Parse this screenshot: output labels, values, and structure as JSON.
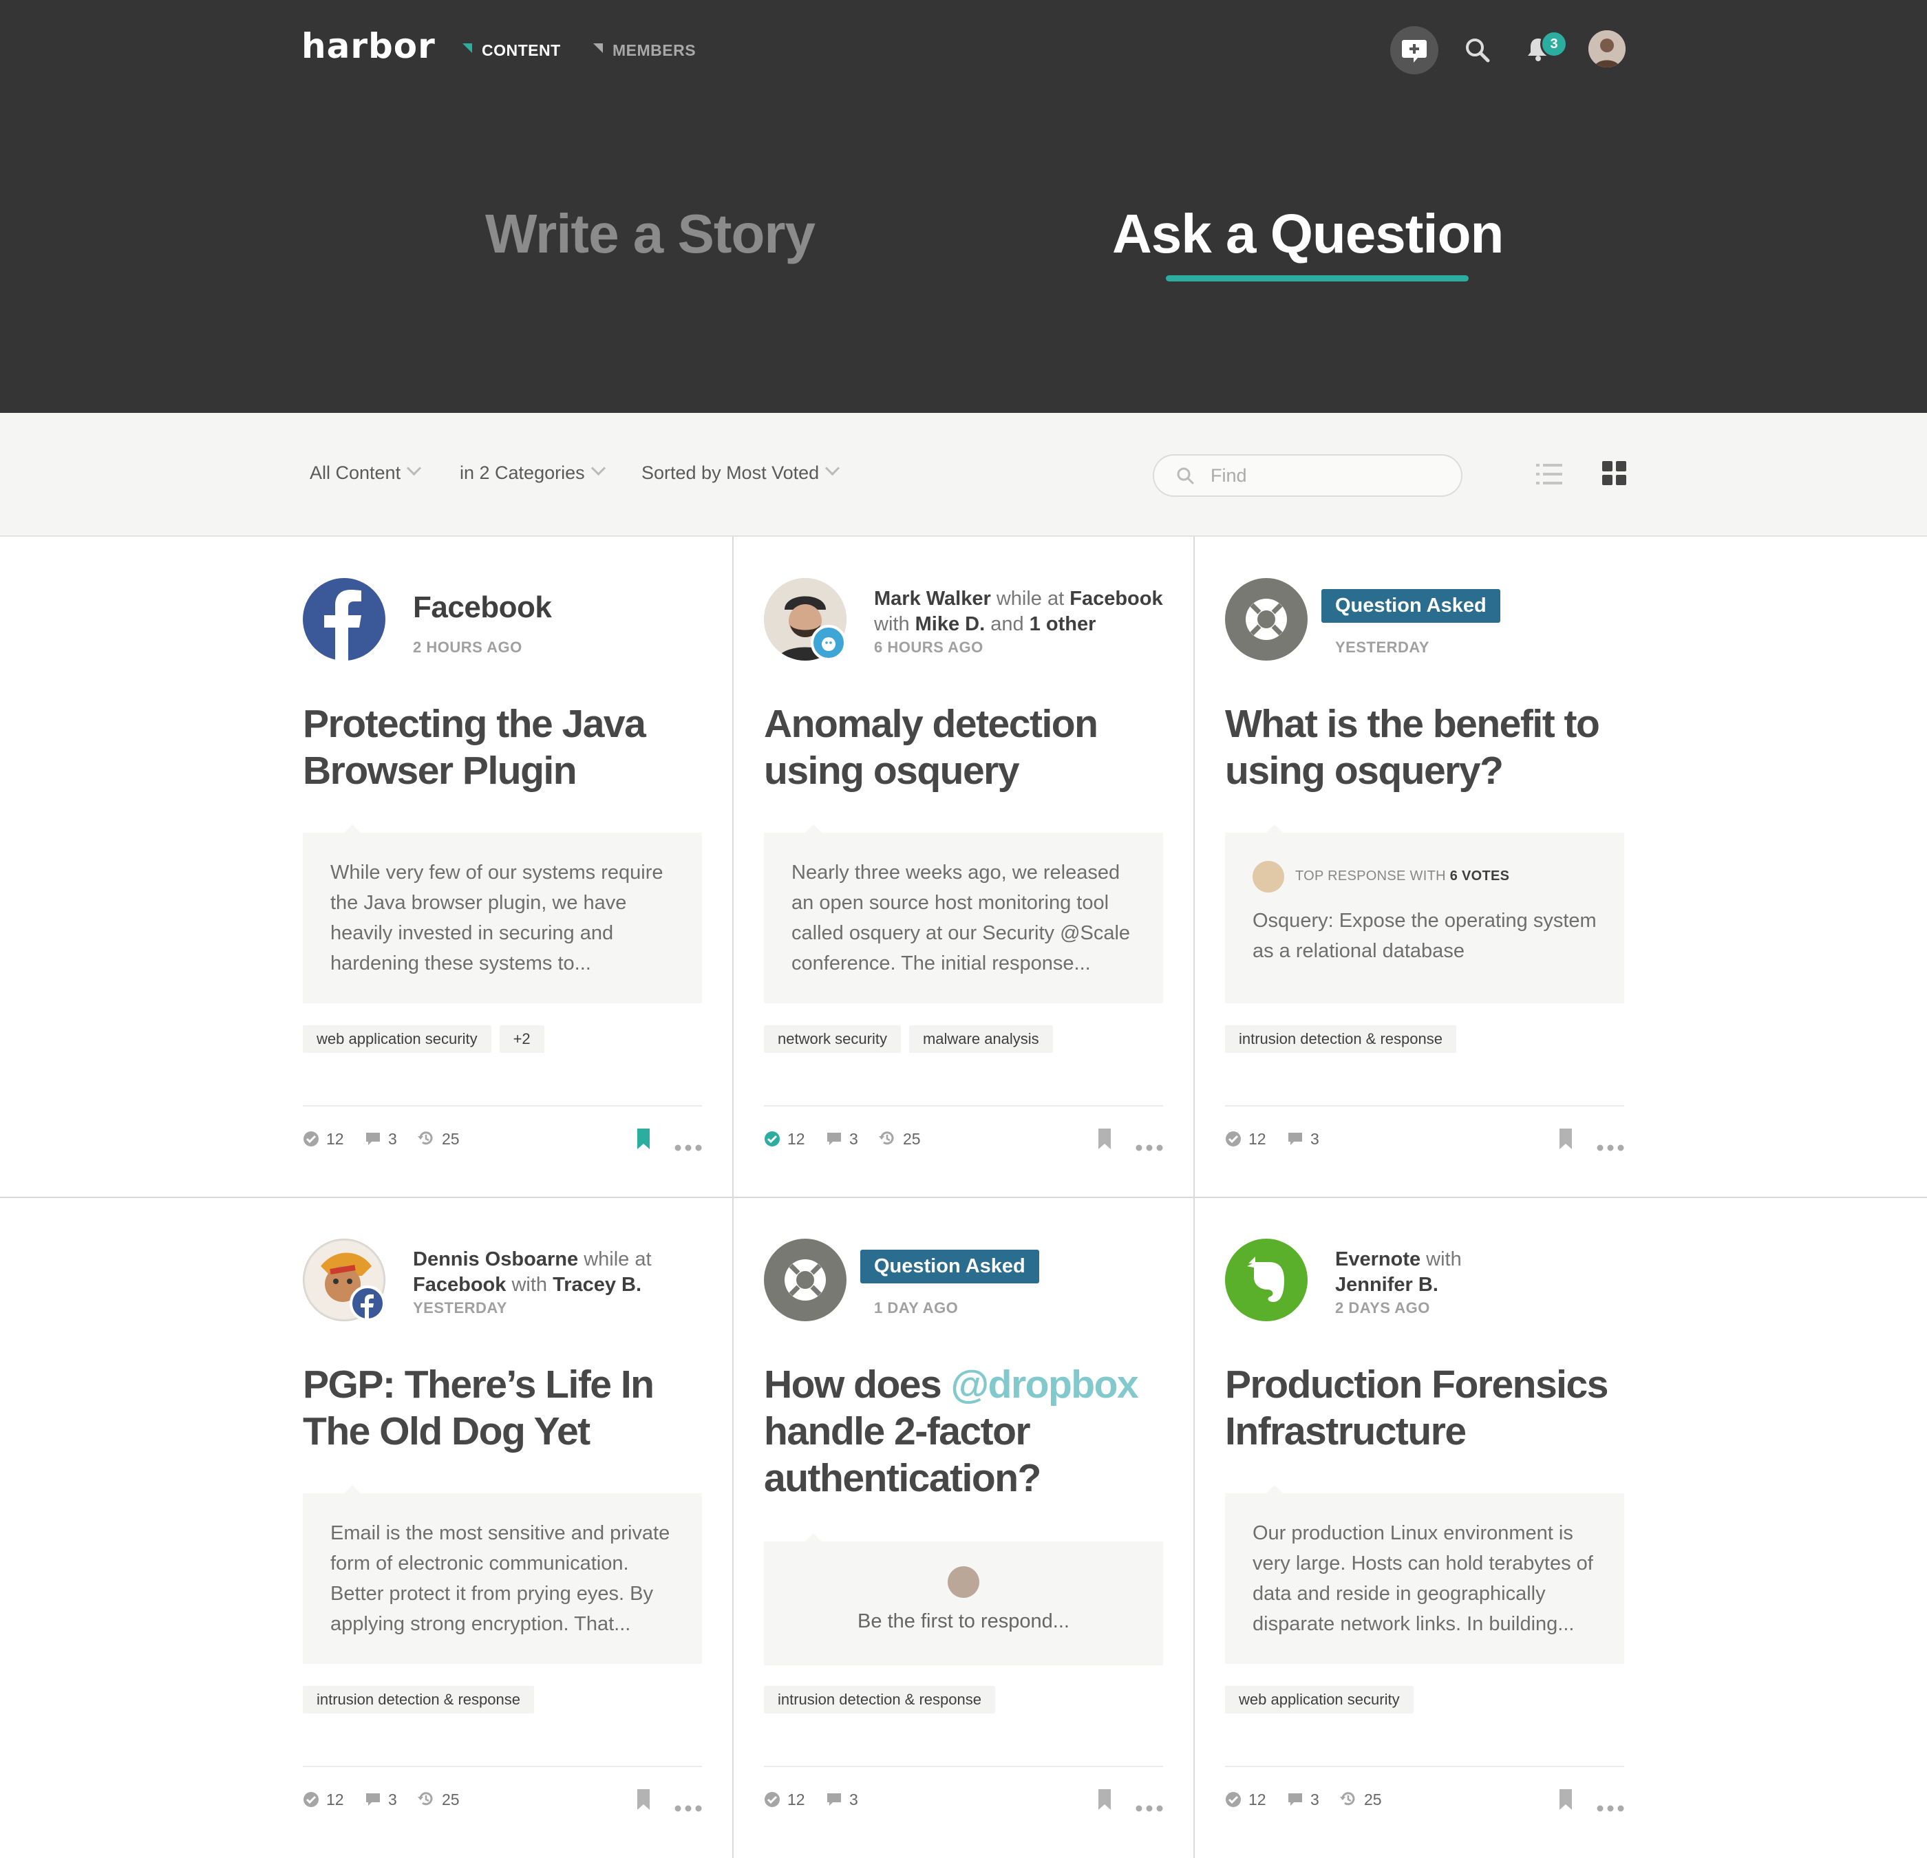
{
  "header": {
    "logo": "harbor",
    "nav": [
      "CONTENT",
      "MEMBERS"
    ],
    "notification_count": "3",
    "tabs": [
      "Write a Story",
      "Ask a Question"
    ]
  },
  "filters": {
    "content": "All Content",
    "categories": "in 2 Categories",
    "sort": "Sorted by Most Voted",
    "find_placeholder": "Find"
  },
  "colors": {
    "accent": "#2bada0",
    "header_bg": "#353535",
    "question_pill": "#2b6d8f",
    "facebook": "#3b5998",
    "evernote": "#5bb02b"
  },
  "cards": [
    {
      "source": "Facebook",
      "time": "2 HOURS AGO",
      "title": "Protecting the Java Browser Plugin",
      "snippet": "While very few of our systems require the Java browser plugin, we have heavily invested in securing and hardening these systems to...",
      "tags": [
        "web application security",
        "+2"
      ],
      "votes": "12",
      "comments": "3",
      "views": "25"
    },
    {
      "author": "Mark Walker",
      "while_at": "while at",
      "org": "Facebook",
      "with": "with",
      "co": "Mike D.",
      "and": "and",
      "other": "1 other",
      "time": "6 HOURS AGO",
      "title": "Anomaly detection using osquery",
      "snippet": "Nearly three weeks ago, we released an open source host monitoring tool called osquery at our Security @Scale conference. The initial response...",
      "tags": [
        "network security",
        "malware analysis"
      ],
      "votes": "12",
      "comments": "3",
      "views": "25"
    },
    {
      "pill": "Question Asked",
      "time": "YESTERDAY",
      "title": "What is the benefit to using osquery?",
      "top_label": "TOP RESPONSE WITH",
      "top_votes": "6 VOTES",
      "snippet": "Osquery: Expose the operating system as a relational database",
      "tags": [
        "intrusion detection & response"
      ],
      "votes": "12",
      "comments": "3"
    },
    {
      "author": "Dennis Osboarne",
      "while_at": "while at",
      "org": "Facebook",
      "with": "with",
      "co": "Tracey B.",
      "time": "YESTERDAY",
      "title": "PGP: There’s Life In The Old Dog Yet",
      "snippet": "Email is the most sensitive and private form of electronic communication. Better protect it from prying eyes. By applying strong encryption. That...",
      "tags": [
        "intrusion detection & response"
      ],
      "votes": "12",
      "comments": "3",
      "views": "25"
    },
    {
      "pill": "Question Asked",
      "time": "1 DAY AGO",
      "title_pre": "How does",
      "title_mention": "@dropbox",
      "title_post": "handle 2-factor authentication?",
      "snippet": "Be the first to respond...",
      "tags": [
        "intrusion detection & response"
      ],
      "votes": "12",
      "comments": "3"
    },
    {
      "org": "Evernote",
      "with": "with",
      "co": "Jennifer B.",
      "time": "2 DAYS AGO",
      "title": "Production Forensics Infrastructure",
      "snippet": "Our production Linux environment is very large. Hosts can hold terabytes of data and reside in geographically disparate network links. In building...",
      "tags": [
        "web application security"
      ],
      "votes": "12",
      "comments": "3",
      "views": "25"
    }
  ]
}
